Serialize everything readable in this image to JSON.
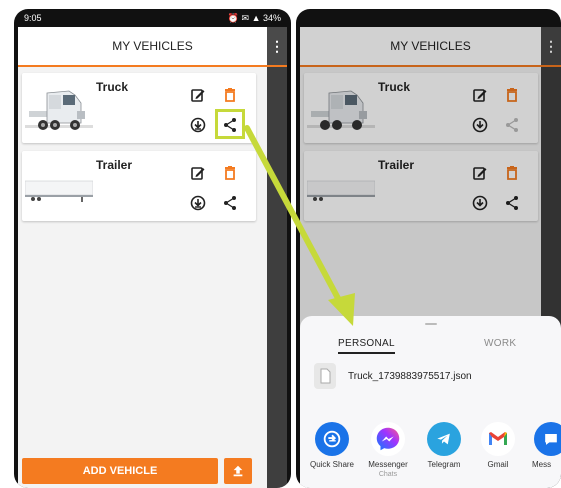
{
  "status_bar": {
    "time": "9:05",
    "icons": "⏰ ✉ ▲ 34%"
  },
  "app": {
    "title": "MY VEHICLES",
    "menu_icon": "⋮"
  },
  "vehicles": [
    {
      "name": "Truck"
    },
    {
      "name": "Trailer"
    }
  ],
  "buttons": {
    "add_vehicle": "ADD VEHICLE"
  },
  "share_sheet": {
    "tabs": [
      "PERSONAL",
      "WORK"
    ],
    "file_name": "Truck_1739883975517.json",
    "apps": [
      {
        "label": "Quick Share",
        "sub": ""
      },
      {
        "label": "Messenger",
        "sub": "Chats"
      },
      {
        "label": "Telegram",
        "sub": ""
      },
      {
        "label": "Gmail",
        "sub": ""
      },
      {
        "label": "Mess",
        "sub": ""
      }
    ]
  },
  "colors": {
    "accent": "#f47b20",
    "highlight": "#c6d93a",
    "active_tab": "#222222",
    "inactive_tab": "#8a8a8a"
  }
}
